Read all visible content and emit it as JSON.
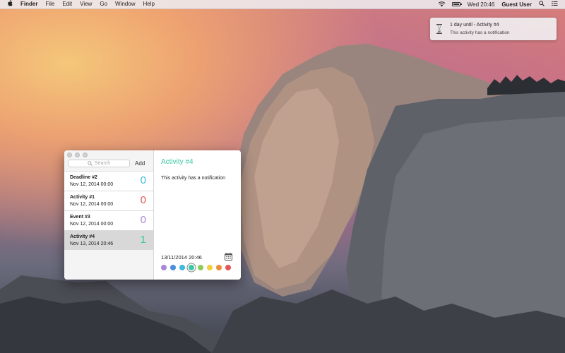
{
  "menubar": {
    "apple_icon": "apple-icon",
    "app": "Finder",
    "menus": [
      "File",
      "Edit",
      "View",
      "Go",
      "Window",
      "Help"
    ],
    "clock": "Wed 20:46",
    "user": "Guest User",
    "status_icons": [
      "wifi-icon",
      "battery-icon",
      "search-icon",
      "list-icon"
    ]
  },
  "notification": {
    "title": "1 day until - Activity #4",
    "body": "This activity has a notification"
  },
  "sidebar": {
    "search_placeholder": "Search",
    "add_label": "Add",
    "items": [
      {
        "title": "Deadline #2",
        "date": "Nov 12, 2014 00:00",
        "count": "0",
        "color": "#41b8e0"
      },
      {
        "title": "Activity #1",
        "date": "Nov 12, 2014 00:00",
        "count": "0",
        "color": "#e25757"
      },
      {
        "title": "Event #3",
        "date": "Nov 12, 2014 00:00",
        "count": "0",
        "color": "#a987d8"
      },
      {
        "title": "Activity #4",
        "date": "Nov 13, 2014 20:46",
        "count": "1",
        "color": "#3cc8a6",
        "selected": true
      }
    ]
  },
  "detail": {
    "title": "Activity #4",
    "body": "This activity has a notification",
    "datetime": "13/11/2014 20:46",
    "calendar_icon": "calendar-icon",
    "colors": [
      "#a987d8",
      "#4a90d9",
      "#41b8e0",
      "#3cc8a6",
      "#8bcc5a",
      "#f2cf3c",
      "#f08a3c",
      "#e25757"
    ],
    "selected_color": "#3cc8a6"
  }
}
